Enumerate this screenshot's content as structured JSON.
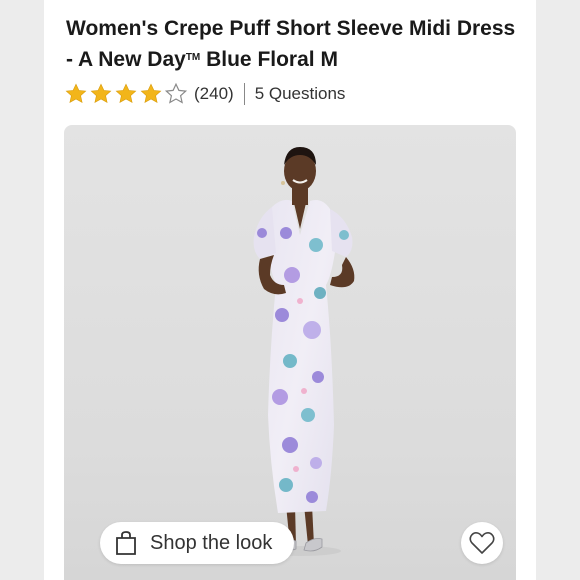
{
  "product": {
    "title_main": "Women's Crepe Puff Short Sleeve Midi Dress - A New Day",
    "title_tm": "TM",
    "title_variant": " Blue Floral M"
  },
  "rating": {
    "stars_filled": 4,
    "stars_total": 5,
    "review_count": "(240)",
    "questions_label": "5 Questions"
  },
  "image": {
    "shop_the_look_label": "Shop the look",
    "bag_icon": "shopping-bag-icon",
    "favorite_icon": "heart-icon"
  },
  "colors": {
    "star": "#f2b51a",
    "text": "#1a1a1a",
    "image_bg": "#e0e0e0"
  }
}
